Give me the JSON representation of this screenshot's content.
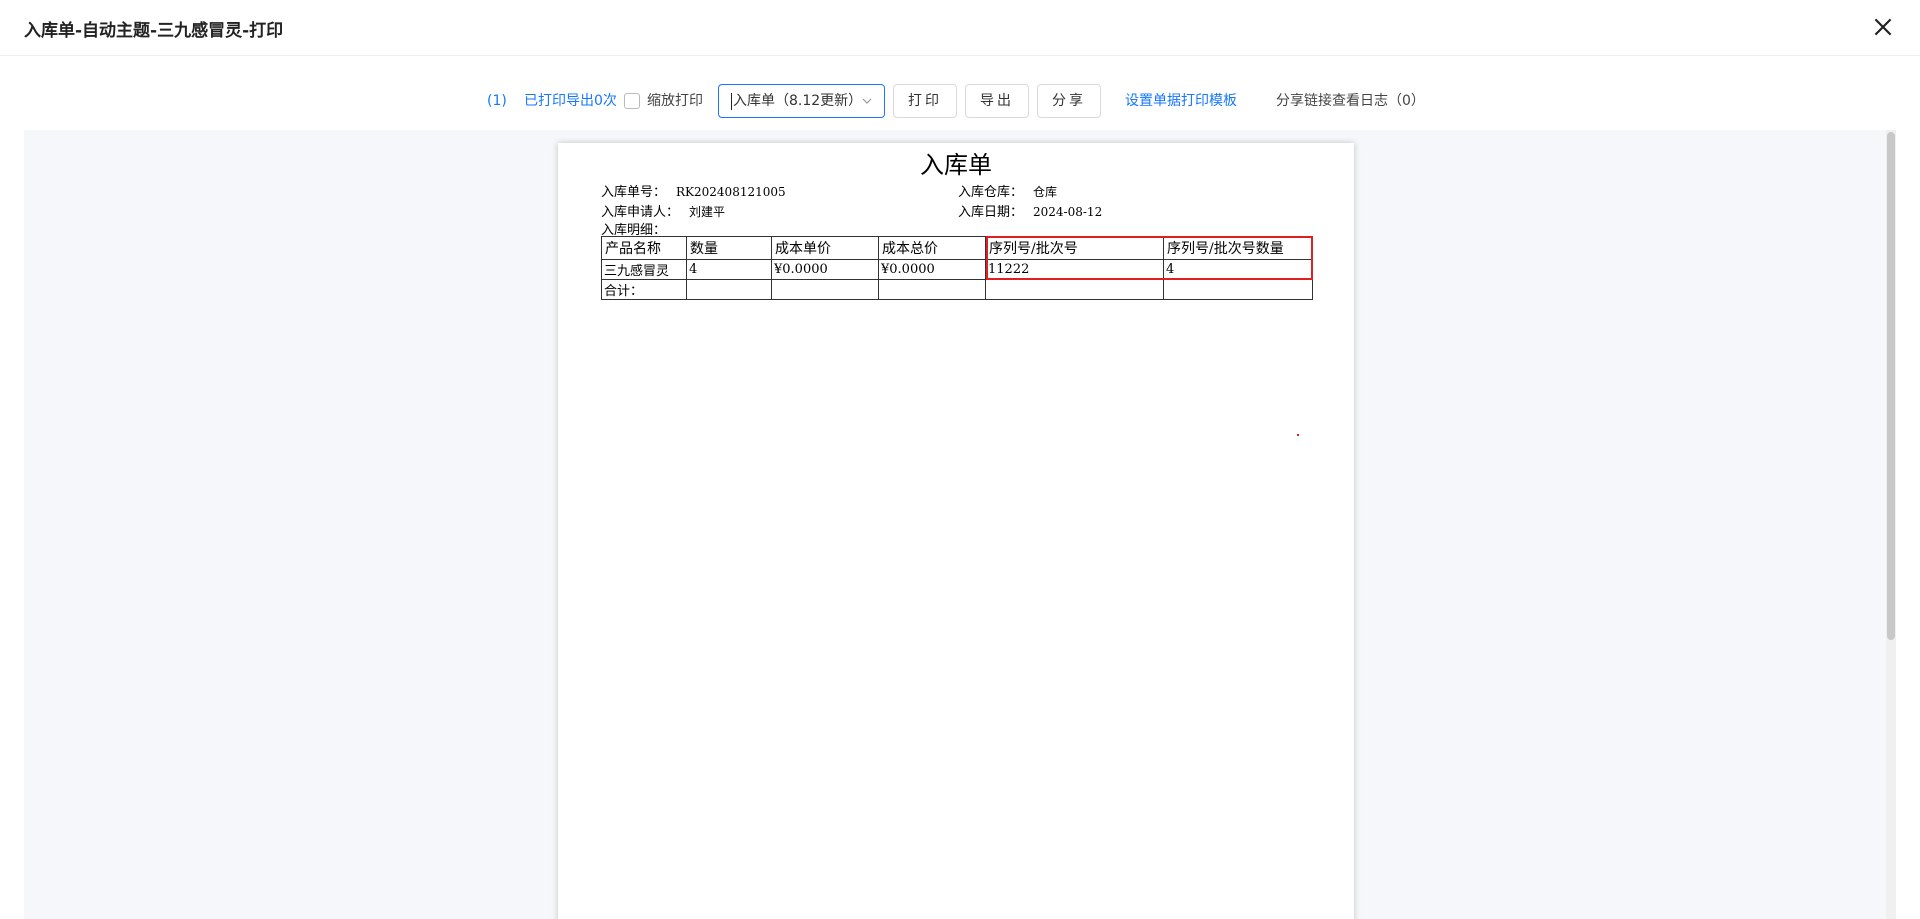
{
  "header": {
    "title": "入库单-自动主题-三九感冒灵-打印"
  },
  "toolbar": {
    "count_label": "(1)",
    "print_export_count": "已打印导出0次",
    "scale_print_label": "缩放打印",
    "template_select": {
      "value": "入库单（8.12更新）"
    },
    "print_button": "打印",
    "export_button": "导出",
    "share_button": "分享",
    "set_template_link": "设置单据打印模板",
    "share_log_link": "分享链接查看日志（0）"
  },
  "document": {
    "title": "入库单",
    "order_no_label": "入库单号：",
    "order_no": "RK202408121005",
    "warehouse_label": "入库仓库：",
    "warehouse": "仓库",
    "applicant_label": "入库申请人：",
    "applicant": "刘建平",
    "date_label": "入库日期：",
    "date": "2024-08-12",
    "detail_label": "入库明细：",
    "table": {
      "headers": [
        "产品名称",
        "数量",
        "成本单价",
        "成本总价",
        "序列号/批次号",
        "序列号/批次号数量"
      ],
      "rows": [
        [
          "三九感冒灵",
          "4",
          "¥0.0000",
          "¥0.0000",
          "11222",
          "4"
        ]
      ],
      "total_label": "合计："
    }
  }
}
